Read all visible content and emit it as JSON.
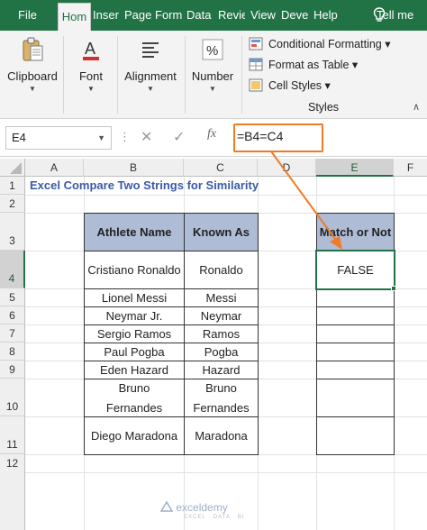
{
  "ribbon_tabs": [
    "File",
    "Hom",
    "Inser",
    "Page",
    "Form",
    "Data",
    "Revie",
    "View",
    "Deve",
    "Help"
  ],
  "tell_me": "Tell me",
  "ribbon_groups": {
    "clipboard": "Clipboard",
    "font": "Font",
    "alignment": "Alignment",
    "number": "Number",
    "styles": "Styles",
    "styles_items": [
      "Conditional Formatting",
      "Format as Table",
      "Cell Styles"
    ]
  },
  "formula_bar": {
    "name_box": "E4",
    "fx": "fx",
    "formula": "=B4=C4"
  },
  "columns": [
    "A",
    "B",
    "C",
    "D",
    "E",
    "F"
  ],
  "rows": [
    "1",
    "2",
    "3",
    "4",
    "5",
    "6",
    "7",
    "8",
    "9",
    "10",
    "11",
    "12"
  ],
  "sheet": {
    "title": "Excel Compare Two Strings for Similarity",
    "headers": [
      "Athlete Name",
      "Known As",
      "Match or Not"
    ],
    "athletes": [
      {
        "name": "Cristiano Ronaldo",
        "known_as": "Ronaldo",
        "match": "FALSE"
      },
      {
        "name": "Lionel Messi",
        "known_as": "Messi",
        "match": ""
      },
      {
        "name": "Neymar Jr.",
        "known_as": "Neymar",
        "match": ""
      },
      {
        "name": "Sergio Ramos",
        "known_as": "Ramos",
        "match": ""
      },
      {
        "name": "Paul Pogba",
        "known_as": "Pogba",
        "match": ""
      },
      {
        "name": "Eden Hazard",
        "known_as": "Hazard",
        "match": ""
      },
      {
        "name": "Bruno Fernandes",
        "known_as": "Bruno Fernandes",
        "match": ""
      },
      {
        "name": "Diego Maradona",
        "known_as": "Maradona",
        "match": ""
      }
    ]
  },
  "active_cell": "E4",
  "colors": {
    "ribbon_green": "#217346",
    "header_fill": "#aebcd6",
    "title_blue": "#3a5aa8",
    "callout_orange": "#f07b27"
  },
  "watermark": {
    "brand": "exceldemy",
    "tagline": "EXCEL · DATA · BI"
  }
}
